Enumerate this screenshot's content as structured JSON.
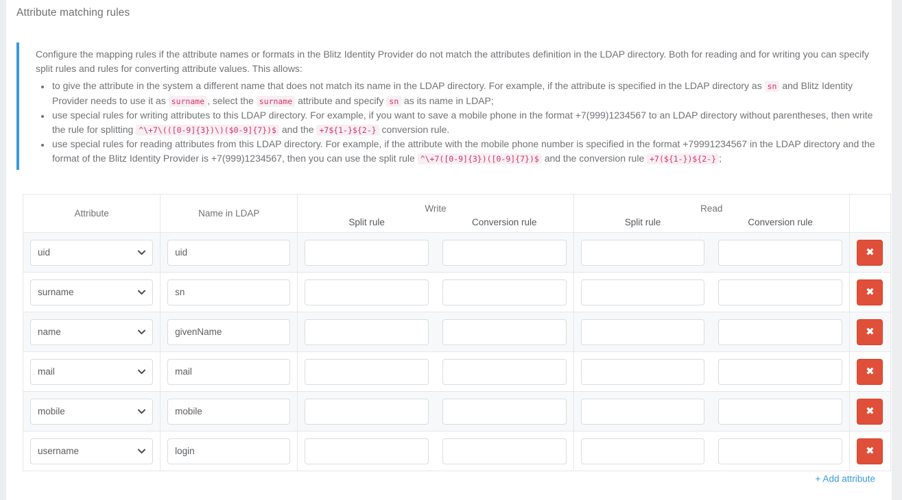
{
  "page": {
    "title": "Attribute matching rules",
    "accent_blue": "#3a9ad9",
    "danger_red": "#e04f39",
    "code_color": "#d6336c"
  },
  "info": {
    "intro": "Configure the mapping rules if the attribute names or formats in the Blitz Identity Provider do not match the attributes definition in the LDAP directory. Both for reading and for writing you can specify split rules and rules for converting attribute values. This allows:",
    "bullets": [
      {
        "p1": "to give the attribute in the system a different name that does not match its name in the LDAP directory. For example, if the attribute is specified in the LDAP directory as",
        "c1": "sn",
        "p2": "and Blitz Identity Provider needs to use it as",
        "c2": "surname",
        "p3": ", select the",
        "c3": "surname",
        "p4": "attribute and specify",
        "c4": "sn",
        "p5": "as its name in LDAP;"
      },
      {
        "p1": "use special rules for writing attributes to this LDAP directory. For example, if you want to save a mobile phone in the format +7(999)1234567 to an LDAP directory without parentheses, then write the rule for splitting",
        "c1": "^\\+7\\(([0-9]{3})\\)($0-9]{7})$",
        "p2": "and the",
        "c2": "+7${1-}${2-}",
        "p3": "conversion rule."
      },
      {
        "p1": "use special rules for reading attributes from this LDAP directory. For example, if the attribute with the mobile phone number is specified in the format +79991234567 in the LDAP directory and the format of the Blitz Identity Provider is +7(999)1234567, then you can use the split rule",
        "c1": "^\\+7([0-9]{3})([0-9]{7})$",
        "p2": "and the conversion rule",
        "c2": "+7(${1-})${2-}",
        "p3": ";"
      }
    ]
  },
  "table": {
    "headers": {
      "attribute": "Attribute",
      "name_in_ldap": "Name in LDAP",
      "write_group": "Write",
      "read_group": "Read",
      "split_rule": "Split rule",
      "conversion_rule": "Conversion rule"
    },
    "delete_icon": "✖",
    "rows": [
      {
        "attribute": "uid",
        "name_in_ldap": "uid",
        "write_split": "",
        "write_conversion": "",
        "read_split": "",
        "read_conversion": ""
      },
      {
        "attribute": "surname",
        "name_in_ldap": "sn",
        "write_split": "",
        "write_conversion": "",
        "read_split": "",
        "read_conversion": ""
      },
      {
        "attribute": "name",
        "name_in_ldap": "givenName",
        "write_split": "",
        "write_conversion": "",
        "read_split": "",
        "read_conversion": ""
      },
      {
        "attribute": "mail",
        "name_in_ldap": "mail",
        "write_split": "",
        "write_conversion": "",
        "read_split": "",
        "read_conversion": ""
      },
      {
        "attribute": "mobile",
        "name_in_ldap": "mobile",
        "write_split": "",
        "write_conversion": "",
        "read_split": "",
        "read_conversion": ""
      },
      {
        "attribute": "username",
        "name_in_ldap": "login",
        "write_split": "",
        "write_conversion": "",
        "read_split": "",
        "read_conversion": ""
      }
    ]
  },
  "footer": {
    "add_attribute": "+ Add attribute"
  }
}
